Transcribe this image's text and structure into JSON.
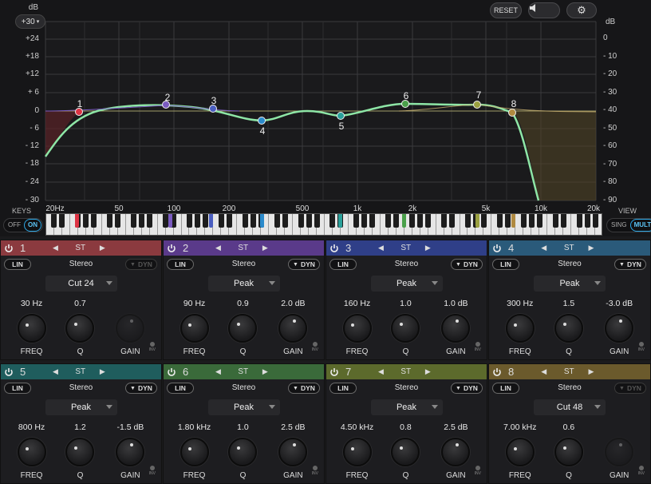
{
  "top": {
    "db_label": "dB",
    "range_value": "+30",
    "reset": "RESET",
    "db_right_label": "dB"
  },
  "db_left": [
    "+24",
    "+18",
    "+12",
    "+ 6",
    "0",
    "- 6",
    "- 12",
    "- 18",
    "- 24",
    "- 30"
  ],
  "db_right": [
    "0",
    "- 10",
    "- 20",
    "- 30",
    "- 40",
    "- 50",
    "- 60",
    "- 70",
    "- 80",
    "- 90"
  ],
  "freq_labels": [
    "20Hz",
    "50",
    "100",
    "200",
    "500",
    "1k",
    "2k",
    "5k",
    "10k",
    "20k"
  ],
  "keys": {
    "label": "KEYS",
    "off": "OFF",
    "on": "ON"
  },
  "view": {
    "label": "VIEW",
    "sing": "SING",
    "mult": "MULT"
  },
  "points": [
    "1",
    "2",
    "3",
    "4",
    "5",
    "6",
    "7",
    "8"
  ],
  "colors": {
    "b1": "#8b3a3f",
    "b2": "#5a3a8a",
    "b3": "#2f3f88",
    "b4": "#2a5a7a",
    "b5": "#1f5d5d",
    "b6": "#3a6a3a",
    "b7": "#5c6a2c",
    "b8": "#6b5a2c",
    "curve": "#8ee6a6",
    "accent": "#2ea8e6"
  },
  "bands": [
    {
      "num": "1",
      "st": "ST",
      "stereo": "Stereo",
      "lin": "LIN",
      "dyn": "DYN",
      "type": "Cut 24",
      "freq": "30 Hz",
      "q": "0.7",
      "gain": "",
      "freq_lbl": "FREQ",
      "q_lbl": "Q",
      "gain_lbl": "GAIN",
      "inv": "INV"
    },
    {
      "num": "2",
      "st": "ST",
      "stereo": "Stereo",
      "lin": "LIN",
      "dyn": "DYN",
      "type": "Peak",
      "freq": "90 Hz",
      "q": "0.9",
      "gain": "2.0 dB",
      "freq_lbl": "FREQ",
      "q_lbl": "Q",
      "gain_lbl": "GAIN",
      "inv": "INV"
    },
    {
      "num": "3",
      "st": "ST",
      "stereo": "Stereo",
      "lin": "LIN",
      "dyn": "DYN",
      "type": "Peak",
      "freq": "160 Hz",
      "q": "1.0",
      "gain": "1.0 dB",
      "freq_lbl": "FREQ",
      "q_lbl": "Q",
      "gain_lbl": "GAIN",
      "inv": "INV"
    },
    {
      "num": "4",
      "st": "ST",
      "stereo": "Stereo",
      "lin": "LIN",
      "dyn": "DYN",
      "type": "Peak",
      "freq": "300 Hz",
      "q": "1.5",
      "gain": "-3.0 dB",
      "freq_lbl": "FREQ",
      "q_lbl": "Q",
      "gain_lbl": "GAIN",
      "inv": "INV"
    },
    {
      "num": "5",
      "st": "ST",
      "stereo": "Stereo",
      "lin": "LIN",
      "dyn": "DYN",
      "type": "Peak",
      "freq": "800 Hz",
      "q": "1.2",
      "gain": "-1.5 dB",
      "freq_lbl": "FREQ",
      "q_lbl": "Q",
      "gain_lbl": "GAIN",
      "inv": "INV"
    },
    {
      "num": "6",
      "st": "ST",
      "stereo": "Stereo",
      "lin": "LIN",
      "dyn": "DYN",
      "type": "Peak",
      "freq": "1.80 kHz",
      "q": "1.0",
      "gain": "2.5 dB",
      "freq_lbl": "FREQ",
      "q_lbl": "Q",
      "gain_lbl": "GAIN",
      "inv": "INV"
    },
    {
      "num": "7",
      "st": "ST",
      "stereo": "Stereo",
      "lin": "LIN",
      "dyn": "DYN",
      "type": "Peak",
      "freq": "4.50 kHz",
      "q": "0.8",
      "gain": "2.5 dB",
      "freq_lbl": "FREQ",
      "q_lbl": "Q",
      "gain_lbl": "GAIN",
      "inv": "INV"
    },
    {
      "num": "8",
      "st": "ST",
      "stereo": "Stereo",
      "lin": "LIN",
      "dyn": "DYN",
      "type": "Cut 48",
      "freq": "7.00 kHz",
      "q": "0.6",
      "gain": "",
      "freq_lbl": "FREQ",
      "q_lbl": "Q",
      "gain_lbl": "GAIN",
      "inv": "INV"
    }
  ]
}
